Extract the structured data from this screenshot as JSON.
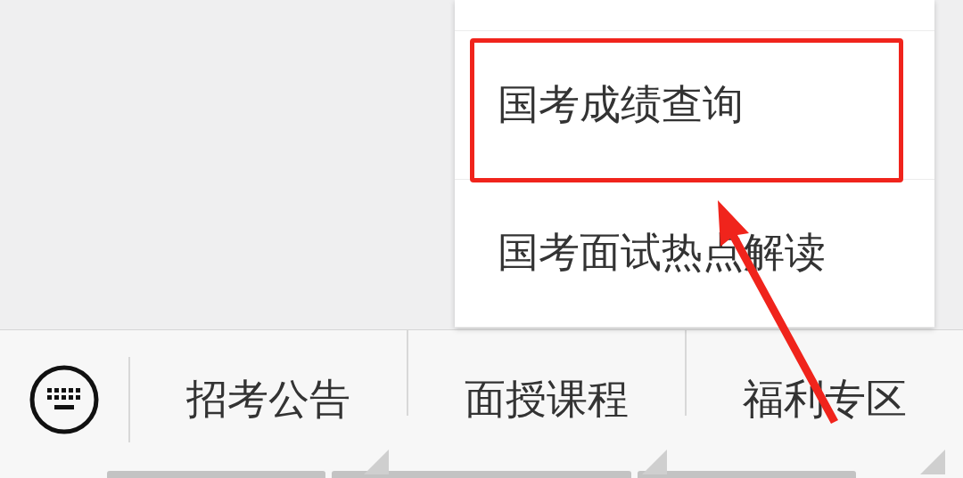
{
  "popup_menu": {
    "items": [
      {
        "label": "国考成绩查询",
        "highlighted": true
      },
      {
        "label": "国考面试热点解读",
        "highlighted": false
      }
    ]
  },
  "bottom_menu": {
    "items": [
      {
        "label": "招考公告",
        "has_submenu": true
      },
      {
        "label": "面授课程",
        "has_submenu": true
      },
      {
        "label": "福利专区",
        "has_submenu": true
      }
    ]
  }
}
